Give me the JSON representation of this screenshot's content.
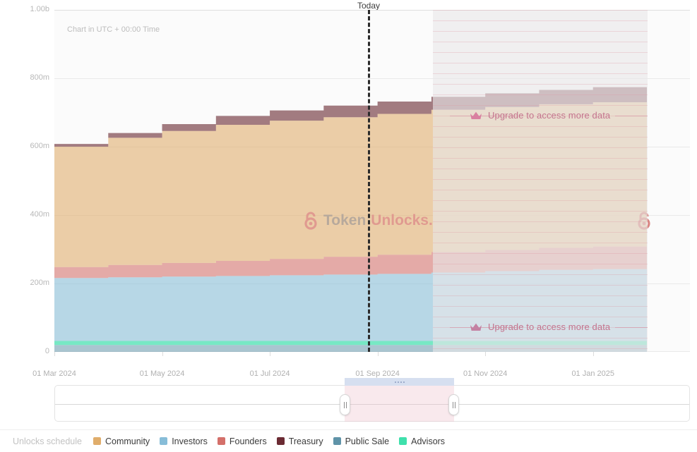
{
  "chart_header": {
    "today_label": "Today",
    "utc_note": "Chart in UTC + 00:00 Time"
  },
  "watermark": {
    "part1": "Token",
    "part2": "Unlocks.",
    "icon": "unlock-padlock-icon",
    "color1": "#b7a99c",
    "color2": "#e09a90"
  },
  "upgrade_overlay": {
    "label": "Upgrade to access more data",
    "icon": "crown-icon",
    "color": "#c4738d"
  },
  "legend": {
    "title": "Unlocks schedule",
    "items": [
      {
        "label": "Community",
        "color": "#e0ad6b"
      },
      {
        "label": "Investors",
        "color": "#87bdd8"
      },
      {
        "label": "Founders",
        "color": "#d4706a"
      },
      {
        "label": "Treasury",
        "color": "#6b2b33"
      },
      {
        "label": "Public Sale",
        "color": "#5f93a8"
      },
      {
        "label": "Advisors",
        "color": "#3fe0ac"
      }
    ]
  },
  "range_selector": {
    "handle_left_icon": "drag-handle-icon",
    "handle_right_icon": "drag-handle-icon",
    "drag_bar_icon": "drag-dots-icon"
  },
  "chart_data": {
    "type": "area",
    "title": "Unlocks schedule",
    "subtitle": "Chart in UTC + 00:00 Time",
    "stacked": true,
    "step": true,
    "xlabel": "",
    "ylabel": "",
    "grid": true,
    "legend_position": "bottom",
    "ylim": [
      0,
      1000000000
    ],
    "ytick_labels": [
      "0",
      "200m",
      "400m",
      "600m",
      "800m",
      "1.00b"
    ],
    "ytick_values": [
      0,
      200000000,
      400000000,
      600000000,
      800000000,
      1000000000
    ],
    "xtick_labels": [
      "01 Mar 2024",
      "01 May 2024",
      "01 Jul 2024",
      "01 Sep 2024",
      "01 Nov 2024",
      "01 Jan 2025"
    ],
    "x": [
      "2024-03-01",
      "2024-04-01",
      "2024-05-01",
      "2024-06-01",
      "2024-07-01",
      "2024-08-01",
      "2024-09-01",
      "2024-10-01",
      "2024-11-01",
      "2024-12-01",
      "2025-01-01",
      "2025-02-01"
    ],
    "annotations": [
      {
        "type": "vline",
        "label": "Today",
        "x": "2024-08-25"
      },
      {
        "type": "mask",
        "label": "Upgrade to access more data",
        "x_start": "2024-09-15",
        "x_end": "2025-02-01"
      }
    ],
    "series": [
      {
        "name": "Public Sale",
        "color": "#5f93a8",
        "values": [
          20000000,
          20000000,
          20000000,
          20000000,
          20000000,
          20000000,
          20000000,
          20000000,
          20000000,
          20000000,
          20000000,
          20000000
        ]
      },
      {
        "name": "Advisors",
        "color": "#3fe0ac",
        "values": [
          12000000,
          12000000,
          12000000,
          12000000,
          12000000,
          12000000,
          12000000,
          12000000,
          12000000,
          12000000,
          12000000,
          12000000
        ]
      },
      {
        "name": "Investors",
        "color": "#87bdd8",
        "values": [
          184000000,
          186000000,
          188000000,
          190000000,
          192000000,
          194000000,
          196000000,
          200000000,
          204000000,
          208000000,
          210000000,
          212000000
        ]
      },
      {
        "name": "Founders",
        "color": "#d4706a",
        "values": [
          32000000,
          36000000,
          40000000,
          44000000,
          48000000,
          52000000,
          56000000,
          60000000,
          62000000,
          64000000,
          66000000,
          68000000
        ]
      },
      {
        "name": "Community",
        "color": "#e0ad6b",
        "values": [
          352000000,
          372000000,
          386000000,
          398000000,
          404000000,
          408000000,
          412000000,
          416000000,
          418000000,
          420000000,
          422000000,
          424000000
        ]
      },
      {
        "name": "Treasury",
        "color": "#6b2b33",
        "values": [
          8000000,
          14000000,
          20000000,
          26000000,
          30000000,
          34000000,
          36000000,
          38000000,
          40000000,
          42000000,
          44000000,
          46000000
        ]
      }
    ],
    "stack_totals": [
      608000000,
      640000000,
      666000000,
      690000000,
      706000000,
      720000000,
      732000000,
      746000000,
      756000000,
      766000000,
      774000000,
      782000000
    ]
  }
}
